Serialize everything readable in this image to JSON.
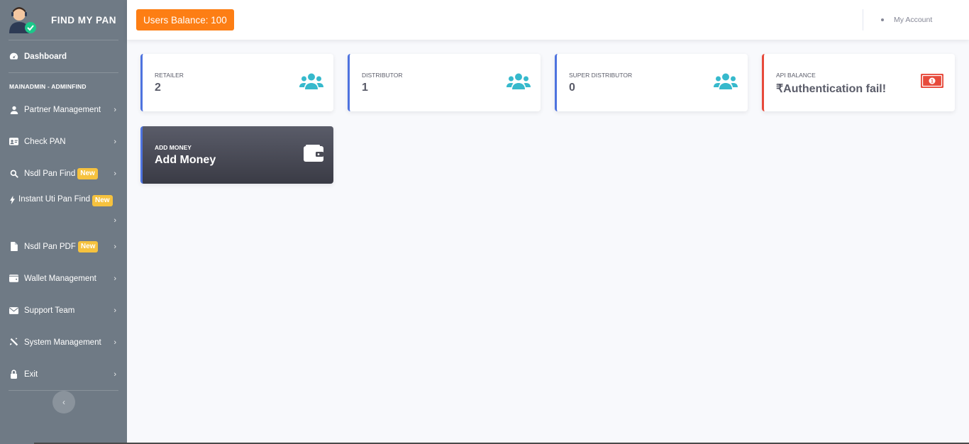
{
  "brand": {
    "name": "FIND MY PAN"
  },
  "sidebar": {
    "dashboard": "Dashboard",
    "heading": "MAINADMIN - ADMINFIND",
    "items": [
      {
        "label": "Partner Management",
        "icon": "user-icon"
      },
      {
        "label": "Check PAN",
        "icon": "id-card-icon"
      },
      {
        "label": "Nsdl Pan Find",
        "icon": "search-icon",
        "badge": "New"
      },
      {
        "label": "Instant Uti Pan Find",
        "icon": "bolt-icon",
        "badge": "New"
      },
      {
        "label": "Nsdl Pan PDF",
        "icon": "file-icon",
        "badge": "New"
      },
      {
        "label": "Wallet Management",
        "icon": "wallet-icon"
      },
      {
        "label": "Support Team",
        "icon": "envelope-icon"
      },
      {
        "label": "System Management",
        "icon": "tools-icon"
      },
      {
        "label": "Exit",
        "icon": "lock-icon"
      }
    ]
  },
  "topbar": {
    "balance": "Users Balance: 100",
    "account": "My Account"
  },
  "cards": [
    {
      "label": "RETAILER",
      "value": "2",
      "icon": "users-icon"
    },
    {
      "label": "DISTRIBUTOR",
      "value": "1",
      "icon": "users-icon"
    },
    {
      "label": "SUPER DISTRIBUTOR",
      "value": "0",
      "icon": "users-icon"
    },
    {
      "label": "API BALANCE",
      "value": "₹Authentication fail!",
      "icon": "money-bill-icon"
    },
    {
      "label": "ADD MONEY",
      "value": "Add Money",
      "icon": "wallet-icon"
    }
  ],
  "colors": {
    "sidebar": "#6f7a85",
    "primary": "#4e73df",
    "danger": "#e74a3b",
    "warning": "#f6c23e",
    "orange": "#fd7e14",
    "info": "#36b9cc"
  }
}
